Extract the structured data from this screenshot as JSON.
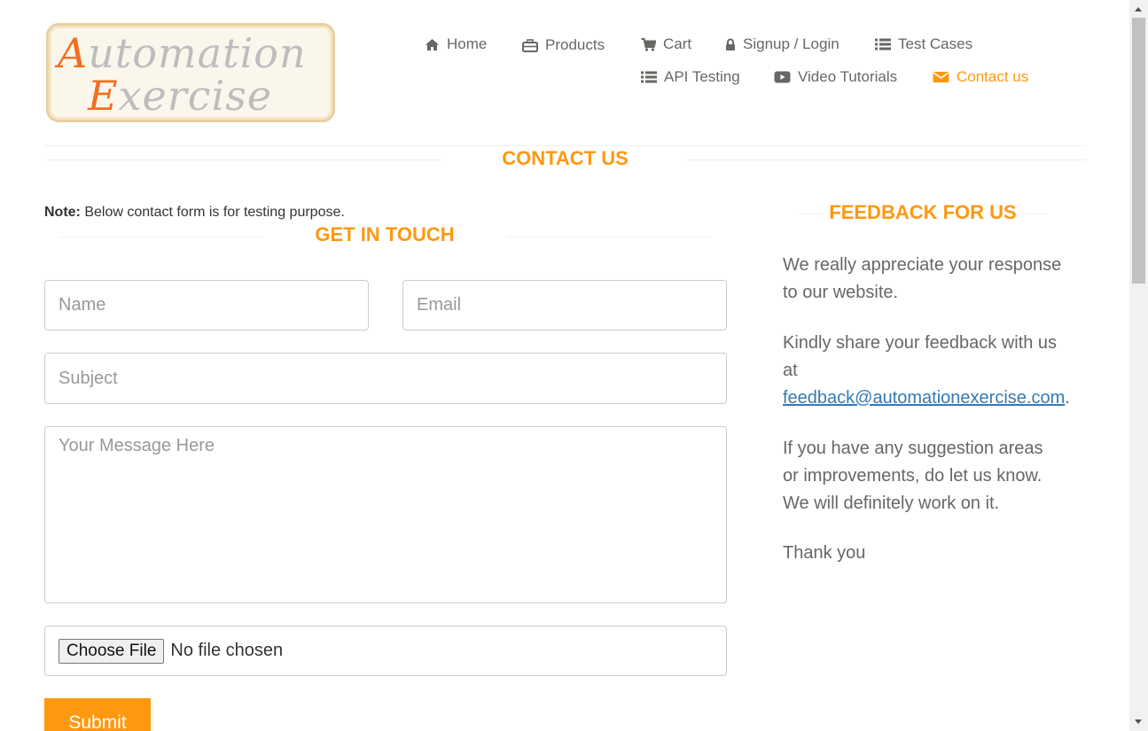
{
  "logo": {
    "line1_cap": "A",
    "line1_rest": "utomation",
    "line2_cap": "E",
    "line2_rest": "xercise"
  },
  "nav": [
    {
      "label": "Home",
      "icon": "home-icon"
    },
    {
      "label": "Products",
      "icon": "briefcase-icon"
    },
    {
      "label": "Cart",
      "icon": "cart-icon"
    },
    {
      "label": "Signup / Login",
      "icon": "lock-icon"
    },
    {
      "label": "Test Cases",
      "icon": "list-icon"
    },
    {
      "label": "API Testing",
      "icon": "list-icon"
    },
    {
      "label": "Video Tutorials",
      "icon": "youtube-icon"
    },
    {
      "label": "Contact us",
      "icon": "envelope-icon",
      "active": true
    }
  ],
  "page_title": "CONTACT US",
  "note": {
    "bold": "Note:",
    "text": "Below contact form is for testing purpose."
  },
  "form": {
    "title": "GET IN TOUCH",
    "name_placeholder": "Name",
    "email_placeholder": "Email",
    "subject_placeholder": "Subject",
    "message_placeholder": "Your Message Here",
    "file_button": "Choose File",
    "file_status": "No file chosen",
    "submit_label": "Submit"
  },
  "feedback": {
    "title": "FEEDBACK FOR US",
    "p1": "We really appreciate your response to our website.",
    "p2_prefix": "Kindly share your feedback with us at",
    "email_link": "feedback@automationexercise.com",
    "p2_suffix": ".",
    "p3": "If you have any suggestion areas or improvements, do let us know. We will definitely work on it.",
    "p4": "Thank you"
  },
  "colors": {
    "accent": "#fe980f",
    "link": "#337ab7",
    "text": "#696763"
  }
}
